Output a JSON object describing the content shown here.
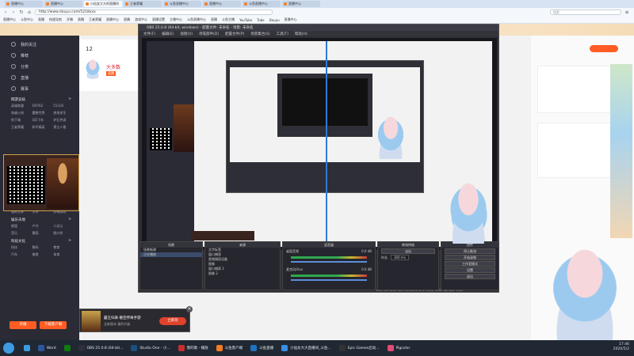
{
  "browser": {
    "tabs": [
      {
        "label": "直播中心",
        "active": false
      },
      {
        "label": "直播中心",
        "active": false
      },
      {
        "label": "小仙女大大的直播间",
        "active": true
      },
      {
        "label": "王者荣耀",
        "active": false
      },
      {
        "label": "斗鱼直播中心",
        "active": false
      },
      {
        "label": "直播中心",
        "active": false
      },
      {
        "label": "斗鱼直播中心",
        "active": false
      },
      {
        "label": "直播中心",
        "active": false
      }
    ],
    "url": "http://www.douyu.com/5218xxx",
    "bookmarks": [
      "直播中心",
      "斗鱼中心",
      "直播",
      "快速导航",
      "开播",
      "直播",
      "王者荣耀",
      "直播中心",
      "直播",
      "游戏中心",
      "直播设置",
      "主播中心",
      "斗鱼直播中心",
      "直播",
      "斗鱼主播",
      "YouTube",
      "Tube",
      "Douyu",
      "直播中心"
    ],
    "search_placeholder": "搜索"
  },
  "douyu_sidebar": {
    "nav": [
      "我的关注",
      "推荐",
      "分类",
      "直播",
      "赛事"
    ],
    "categories": [
      {
        "title": "网游竞技",
        "more": ">",
        "items": [
          "英雄联盟",
          "DOTA2",
          "CS:GO",
          "穿越火线",
          "魔兽世界",
          "绝地求生",
          "地下城",
          "QQ飞车",
          "炉石传说",
          "王者荣耀",
          "和平精英",
          "第五人格"
        ]
      },
      {
        "title": "单机热游",
        "more": ">",
        "items": [
          "主机游戏",
          "怀旧游戏",
          "独立游戏",
          "我的世界",
          "方舟",
          "恐怖游戏"
        ]
      },
      {
        "title": "娱乐天地",
        "more": ">",
        "items": [
          "颜值",
          "户外",
          "二次元",
          "音乐",
          "舞蹈",
          "脱口秀"
        ]
      },
      {
        "title": "科技文化",
        "more": ">",
        "items": [
          "科技",
          "数码",
          "教育",
          "汽车",
          "美食",
          "体育"
        ]
      }
    ],
    "bottom_buttons": [
      "开播",
      "下载客户端"
    ]
  },
  "stream_info": {
    "count": "12",
    "streamer_name": "大多数",
    "badge": "直播"
  },
  "obs": {
    "title": "OBS 25.0.8 (64-bit, windows) - 配置文件: 未命名 - 场景: 未命名",
    "menu": [
      "文件(F)",
      "编辑(E)",
      "视图(V)",
      "停靠部件(D)",
      "配置文件(P)",
      "场景集合(S)",
      "工具(T)",
      "帮助(H)"
    ],
    "docks": {
      "scenes": {
        "title": "场景",
        "items": [
          "场景新建",
          "正在播放"
        ]
      },
      "sources": {
        "title": "来源",
        "items": [
          "文字标签",
          "窗口捕获",
          "视频捕获设备",
          "图像",
          "窗口捕获 2",
          "图像 2"
        ]
      },
      "mixer": {
        "title": "混音器",
        "tracks": [
          {
            "label": "桌面音频",
            "db": "0.0 dB"
          },
          {
            "label": "麦克风/Aux",
            "db": "0.0 dB"
          }
        ]
      },
      "transitions": {
        "title": "转场特效",
        "type": "淡出",
        "duration_label": "时长",
        "duration": "300 ms"
      },
      "controls": {
        "title": "控件",
        "buttons": [
          "停止推流",
          "开始录制",
          "工作室模式",
          "设置",
          "退出"
        ]
      }
    },
    "status": "LIVE: 00:32:49  REC: 00:00:00  CPU: 4.4%, 30.00 fps  kb/s: 2561"
  },
  "ad": {
    "title": "霸王归来-散空传奇手游",
    "subtitle": "全新版本 福利升级",
    "button": "立即玩"
  },
  "taskbar": {
    "items": [
      {
        "label": "",
        "color": "#3f9ae0"
      },
      {
        "label": "Word",
        "color": "#2b579a"
      },
      {
        "label": "",
        "color": "#0f7b0f"
      },
      {
        "label": "OBS 25.0.8 (64-bit...",
        "color": "#302f3a"
      },
      {
        "label": "Studio One - 小...",
        "color": "#1c4f7c"
      },
      {
        "label": "我的歌 - 播放",
        "color": "#c62f2f"
      },
      {
        "label": "斗鱼客户端",
        "color": "#f57c20"
      },
      {
        "label": "斗鱼直播",
        "color": "#1e73be"
      },
      {
        "label": "小仙女大大直播间_斗鱼...",
        "color": "#3b8fe3"
      },
      {
        "label": "Epic Games启动...",
        "color": "#333333"
      },
      {
        "label": "Pigcolor",
        "color": "#e24c75"
      }
    ],
    "clock_time": "17:46",
    "clock_date": "2020/5/2"
  }
}
